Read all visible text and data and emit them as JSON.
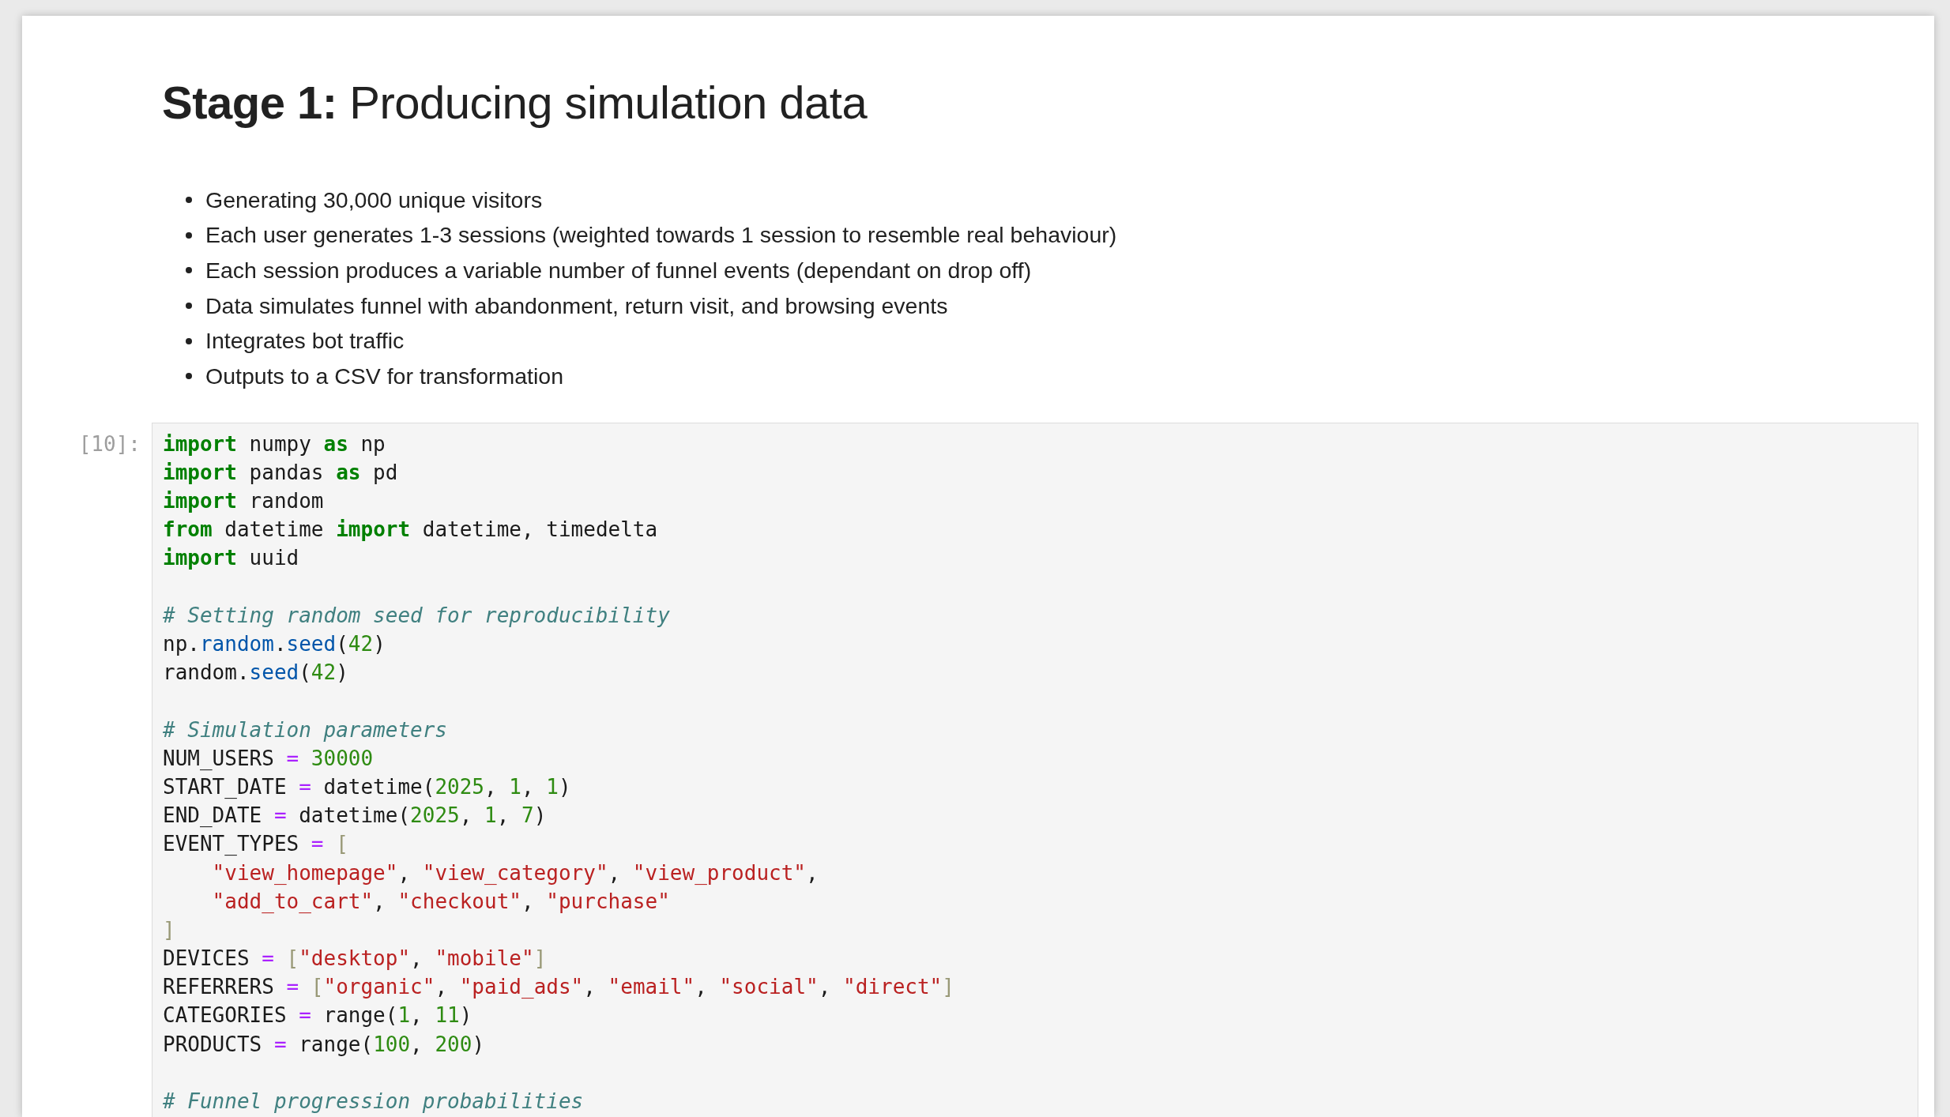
{
  "notebook": {
    "cells": [
      {
        "kind": "markdown",
        "heading": "**Stage 1:** Producing simulation data",
        "bullets": [
          "Generating 30,000 unique visitors",
          "Each user generates 1-3 sessions (weighted towards 1 session to resemble real behaviour)",
          "Each session produces a variable number of funnel events (dependant on drop off)",
          "Data simulates funnel with abandonment, return visit, and browsing events",
          "Integrates bot traffic",
          "Outputs to a CSV for transformation"
        ]
      },
      {
        "kind": "code",
        "prompt": "[10]:",
        "blocks": [
          [
            [
              {
                "kind": "keyword",
                "text": "import"
              },
              {
                "kind": "name",
                "text": " numpy "
              },
              {
                "kind": "keyword",
                "text": "as"
              },
              {
                "kind": "name",
                "text": " np"
              }
            ],
            [
              {
                "kind": "keyword",
                "text": "import"
              },
              {
                "kind": "name",
                "text": " pandas "
              },
              {
                "kind": "keyword",
                "text": "as"
              },
              {
                "kind": "name",
                "text": " pd"
              }
            ],
            [
              {
                "kind": "keyword",
                "text": "import"
              },
              {
                "kind": "name",
                "text": " random"
              }
            ],
            [
              {
                "kind": "keyword",
                "text": "from"
              },
              {
                "kind": "name",
                "text": " datetime "
              },
              {
                "kind": "keyword",
                "text": "import"
              },
              {
                "kind": "name",
                "text": " datetime, timedelta"
              }
            ],
            [
              {
                "kind": "keyword",
                "text": "import"
              },
              {
                "kind": "name",
                "text": " uuid"
              }
            ]
          ],
          [
            [
              {
                "kind": "comment",
                "text": "# Setting random seed for reproducibility"
              }
            ],
            [
              {
                "kind": "name",
                "text": "np."
              },
              {
                "kind": "property",
                "text": "random"
              },
              {
                "kind": "name",
                "text": "."
              },
              {
                "kind": "property",
                "text": "seed"
              },
              {
                "kind": "name",
                "text": "("
              },
              {
                "kind": "number",
                "text": "42"
              },
              {
                "kind": "name",
                "text": ")"
              }
            ],
            [
              {
                "kind": "name",
                "text": "random."
              },
              {
                "kind": "property",
                "text": "seed"
              },
              {
                "kind": "name",
                "text": "("
              },
              {
                "kind": "number",
                "text": "42"
              },
              {
                "kind": "name",
                "text": ")"
              }
            ]
          ],
          [
            [
              {
                "kind": "comment",
                "text": "# Simulation parameters"
              }
            ],
            [
              {
                "kind": "name",
                "text": "NUM_USERS "
              },
              {
                "kind": "operator",
                "text": "= "
              },
              {
                "kind": "number",
                "text": "30000"
              }
            ],
            [
              {
                "kind": "name",
                "text": "START_DATE "
              },
              {
                "kind": "operator",
                "text": "="
              },
              {
                "kind": "name",
                "text": " datetime("
              },
              {
                "kind": "number",
                "text": "2025"
              },
              {
                "kind": "name",
                "text": ", "
              },
              {
                "kind": "number",
                "text": "1"
              },
              {
                "kind": "name",
                "text": ", "
              },
              {
                "kind": "number",
                "text": "1"
              },
              {
                "kind": "name",
                "text": ")"
              }
            ],
            [
              {
                "kind": "name",
                "text": "END_DATE "
              },
              {
                "kind": "operator",
                "text": "="
              },
              {
                "kind": "name",
                "text": " datetime("
              },
              {
                "kind": "number",
                "text": "2025"
              },
              {
                "kind": "name",
                "text": ", "
              },
              {
                "kind": "number",
                "text": "1"
              },
              {
                "kind": "name",
                "text": ", "
              },
              {
                "kind": "number",
                "text": "7"
              },
              {
                "kind": "name",
                "text": ")"
              }
            ],
            [
              {
                "kind": "name",
                "text": "EVENT_TYPES "
              },
              {
                "kind": "operator",
                "text": "= "
              },
              {
                "kind": "bracket",
                "text": "["
              }
            ],
            [
              {
                "kind": "string",
                "text": "    \"view_homepage\""
              },
              {
                "kind": "name",
                "text": ", "
              },
              {
                "kind": "string",
                "text": "\"view_category\""
              },
              {
                "kind": "name",
                "text": ", "
              },
              {
                "kind": "string",
                "text": "\"view_product\""
              },
              {
                "kind": "name",
                "text": ","
              }
            ],
            [
              {
                "kind": "string",
                "text": "    \"add_to_cart\""
              },
              {
                "kind": "name",
                "text": ", "
              },
              {
                "kind": "string",
                "text": "\"checkout\""
              },
              {
                "kind": "name",
                "text": ", "
              },
              {
                "kind": "string",
                "text": "\"purchase\""
              }
            ],
            [
              {
                "kind": "bracket",
                "text": "]"
              }
            ],
            [
              {
                "kind": "name",
                "text": "DEVICES "
              },
              {
                "kind": "operator",
                "text": "= "
              },
              {
                "kind": "bracket",
                "text": "["
              },
              {
                "kind": "string",
                "text": "\"desktop\""
              },
              {
                "kind": "name",
                "text": ", "
              },
              {
                "kind": "string",
                "text": "\"mobile\""
              },
              {
                "kind": "bracket",
                "text": "]"
              }
            ],
            [
              {
                "kind": "name",
                "text": "REFERRERS "
              },
              {
                "kind": "operator",
                "text": "= "
              },
              {
                "kind": "bracket",
                "text": "["
              },
              {
                "kind": "string",
                "text": "\"organic\""
              },
              {
                "kind": "name",
                "text": ", "
              },
              {
                "kind": "string",
                "text": "\"paid_ads\""
              },
              {
                "kind": "name",
                "text": ", "
              },
              {
                "kind": "string",
                "text": "\"email\""
              },
              {
                "kind": "name",
                "text": ", "
              },
              {
                "kind": "string",
                "text": "\"social\""
              },
              {
                "kind": "name",
                "text": ", "
              },
              {
                "kind": "string",
                "text": "\"direct\""
              },
              {
                "kind": "bracket",
                "text": "]"
              }
            ],
            [
              {
                "kind": "name",
                "text": "CATEGORIES "
              },
              {
                "kind": "operator",
                "text": "="
              },
              {
                "kind": "name",
                "text": " range("
              },
              {
                "kind": "number",
                "text": "1"
              },
              {
                "kind": "name",
                "text": ", "
              },
              {
                "kind": "number",
                "text": "11"
              },
              {
                "kind": "name",
                "text": ")"
              }
            ],
            [
              {
                "kind": "name",
                "text": "PRODUCTS "
              },
              {
                "kind": "operator",
                "text": "="
              },
              {
                "kind": "name",
                "text": " range("
              },
              {
                "kind": "number",
                "text": "100"
              },
              {
                "kind": "name",
                "text": ", "
              },
              {
                "kind": "number",
                "text": "200"
              },
              {
                "kind": "name",
                "text": ")"
              }
            ]
          ],
          [
            [
              {
                "kind": "comment",
                "text": "# Funnel progression probabilities"
              }
            ]
          ]
        ]
      }
    ]
  }
}
